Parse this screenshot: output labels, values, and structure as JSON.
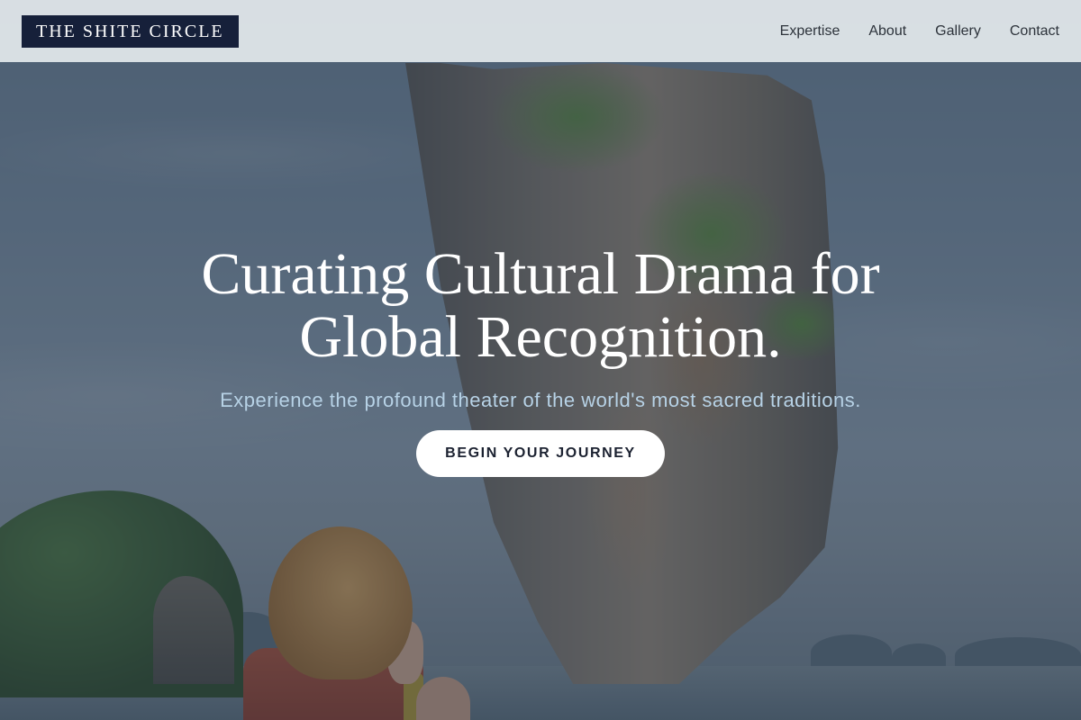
{
  "header": {
    "logo_text": "THE SHITE CIRCLE",
    "nav": [
      {
        "label": "Expertise"
      },
      {
        "label": "About"
      },
      {
        "label": "Gallery"
      },
      {
        "label": "Contact"
      }
    ]
  },
  "hero": {
    "title_line1": "Curating Cultural Drama for",
    "title_line2": "Global Recognition.",
    "subtitle": "Experience the profound theater of the world's most sacred traditions.",
    "cta_label": "BEGIN YOUR JOURNEY"
  },
  "colors": {
    "logo_background": "#16203a",
    "header_background": "#ecf0f3",
    "subtitle_text": "#b7d2e6",
    "cta_background": "#ffffff"
  }
}
